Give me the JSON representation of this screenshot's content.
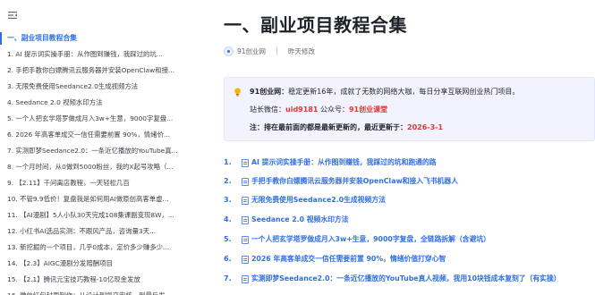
{
  "sidebar": {
    "items": [
      {
        "label": "一、副业项目教程合集",
        "active": true
      },
      {
        "label": "1. AI 提示词实操手册：从作图到赚钱，我踩过的坑...",
        "active": false
      },
      {
        "label": "2. 手把手教你白嫖腾讯云服务器并安装OpenClaw和接...",
        "active": false
      },
      {
        "label": "3. 无限免费使用Seedance2.0生成视频方法",
        "active": false
      },
      {
        "label": "4. Seedance 2.0 视频水印方法",
        "active": false
      },
      {
        "label": "5. 一个人把玄学塔罗做成月入3w+生意，9000字复盘...",
        "active": false
      },
      {
        "label": "6. 2026 年高客单成交一信任需要前置 90%，情绪价...",
        "active": false
      },
      {
        "label": "7. 实测即梦Seedance2.0：一条近亿播放的YouTube真...",
        "active": false
      },
      {
        "label": "8. 一个月时间，从0做到5000粉丝，我的X起号攻略（...",
        "active": false
      },
      {
        "label": "9. 【2.11】千问离店教程，一天轻松几百",
        "active": false
      },
      {
        "label": "10. 不管9.9低价！复盘我是如何用AI做原创高客单虚...",
        "active": false
      },
      {
        "label": "11. 【AI漫剧】5人小队30天完成108集课副变现8W，...",
        "active": false
      },
      {
        "label": "12. 小红书AI选品实测：不跟风产品，咨询量3天...",
        "active": false
      },
      {
        "label": "13. 新挖掘的一个项目，几乎0成本，定价多少赚多少...",
        "active": false
      },
      {
        "label": "14. 【2.3】AIGC漫剧分发赔酬项目",
        "active": false
      },
      {
        "label": "15. 【2.1】腾讯元宝技巧教程-10亿现金发放",
        "active": false
      },
      {
        "label": "16. 微信红包封面制作：从设计到提交审核、到最后发...",
        "active": false
      }
    ]
  },
  "document": {
    "title": "一、副业项目教程合集",
    "author": "91创业网",
    "modified": "昨天修改"
  },
  "callout": {
    "line1_label": "91创业网：",
    "line1_text": "稳定更新16年，成就了无数的网络大咖，每日分享互联网创业热门项目。",
    "wechat_label": "站长微信：",
    "wechat_value": "uid9181",
    "official_label": "  公众号：",
    "official_value": "91创业课堂",
    "note_label": "注：排在最前面的都是最新更新的，最近更新于：",
    "note_date": "2026-3-1"
  },
  "list": [
    {
      "num": "1.",
      "label": "AI 提示词实操手册：从作图到赚钱，我踩过的坑和跑通的路"
    },
    {
      "num": "2.",
      "label": "手把手教你白嫖腾讯云服务器并安装OpenClaw和接入飞书机器人"
    },
    {
      "num": "3.",
      "label": "无限免费使用Seedance2.0生成视频方法"
    },
    {
      "num": "4.",
      "label": "Seedance 2.0 视频水印方法"
    },
    {
      "num": "5.",
      "label": "一个人把玄学塔罗做成月入3w+生意，9000字复盘，全链路拆解（含避坑）"
    },
    {
      "num": "6.",
      "label": "2026 年高客单成交一信任需要前置 90%，情绪价值打穿心智"
    },
    {
      "num": "7.",
      "label": "实测即梦Seedance2.0：一条近亿播放的YouTube真人视频，我用10块钱成本复刻了（有实操）"
    }
  ],
  "colors": {
    "accent": "#2f6fe4",
    "highlight_red": "#d83931",
    "callout_bg": "#f2f3ff"
  },
  "icons": {
    "collapse": "collapse-icon",
    "bulb": "lightbulb-icon",
    "doc": "document-icon"
  }
}
